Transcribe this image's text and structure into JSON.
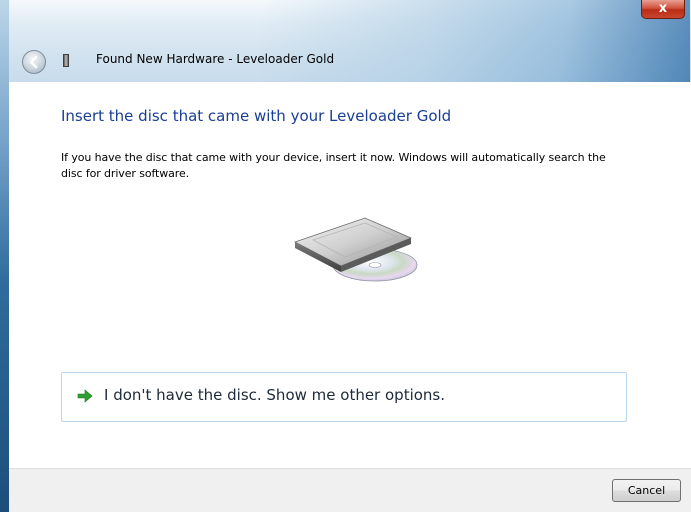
{
  "window": {
    "title": "Found New Hardware - Leveloader Gold",
    "close_label": "x"
  },
  "content": {
    "main_instruction": "Insert the disc that came with your Leveloader Gold",
    "body_text": "If you have the disc that came with your device, insert it now.  Windows will automatically search the disc for driver software.",
    "image_icon": "disc-drive-icon",
    "link_icon": "green-arrow-icon",
    "link_label": "I don't have the disc.  Show me other options."
  },
  "footer": {
    "cancel_label": "Cancel"
  },
  "colors": {
    "instruction_blue": "#1a3e96",
    "link_border": "#b9d5ec",
    "arrow_green": "#2e9e2e",
    "close_red": "#c9452e"
  }
}
